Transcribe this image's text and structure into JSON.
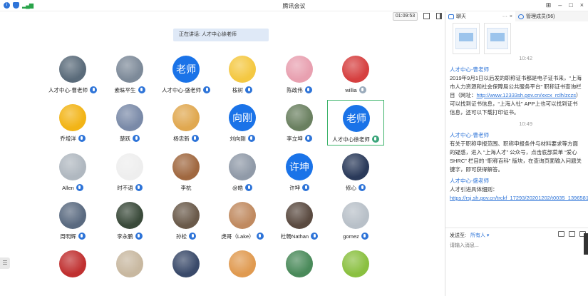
{
  "window": {
    "title": "腾讯会议",
    "timer": "01:09:53"
  },
  "speaker_banner": "正在讲话: 人才中心徐老师",
  "participants": [
    {
      "name": "人才中心-曹老师",
      "avatar": "photo",
      "color": "#5a6b7a",
      "mic": "on"
    },
    {
      "name": "素昧平生",
      "avatar": "photo",
      "color": "#7d8a99",
      "mic": "on"
    },
    {
      "name": "人才中心-盛老师",
      "avatar": "text",
      "avatar_text": "老师",
      "mic": "on"
    },
    {
      "name": "桉树",
      "avatar": "photo",
      "color": "#f4c842",
      "mic": "on"
    },
    {
      "name": "陈政伟",
      "avatar": "photo",
      "color": "#e8a0b0",
      "mic": "on"
    },
    {
      "name": "willia",
      "avatar": "photo",
      "color": "#d64040",
      "mic": "dim"
    },
    {
      "name": "乔增洋",
      "avatar": "photo",
      "color": "#f2b416",
      "mic": "on"
    },
    {
      "name": "楚跃",
      "avatar": "photo",
      "color": "#7a8aa8",
      "mic": "on"
    },
    {
      "name": "杨忠新",
      "avatar": "photo",
      "color": "#e0a850",
      "mic": "on"
    },
    {
      "name": "刘向刚",
      "avatar": "text",
      "avatar_text": "向刚",
      "mic": "on"
    },
    {
      "name": "李立坤",
      "avatar": "photo",
      "color": "#6a8060",
      "mic": "on"
    },
    {
      "name": "人才中心徐老师",
      "avatar": "text",
      "avatar_text": "老师",
      "mic": "speaking",
      "active": true
    },
    {
      "name": "Allen",
      "avatar": "photo",
      "color": "#b0b8c0",
      "mic": "on"
    },
    {
      "name": "时不语",
      "avatar": "photo",
      "color": "#eeeeee",
      "mic": "on"
    },
    {
      "name": "李杭",
      "avatar": "photo",
      "color": "#a06840",
      "mic": "none"
    },
    {
      "name": "@皓",
      "avatar": "photo",
      "color": "#909aa8",
      "mic": "on"
    },
    {
      "name": "许坤",
      "avatar": "text",
      "avatar_text": "许坤",
      "mic": "on"
    },
    {
      "name": "修心",
      "avatar": "photo",
      "color": "#2a3a5a",
      "mic": "on"
    },
    {
      "name": "周明辉",
      "avatar": "photo",
      "color": "#5a6a80",
      "mic": "on"
    },
    {
      "name": "李永鹏",
      "avatar": "photo",
      "color": "#3a4a3a",
      "mic": "on"
    },
    {
      "name": "孙松",
      "avatar": "photo",
      "color": "#6a5a4a",
      "mic": "on"
    },
    {
      "name": "虎哥（Lake）",
      "avatar": "photo",
      "color": "#c08a60",
      "mic": "on"
    },
    {
      "name": "杜畅Nathan",
      "avatar": "photo",
      "color": "#5a4a40",
      "mic": "on"
    },
    {
      "name": "gomez",
      "avatar": "photo",
      "color": "#b8c0c8",
      "mic": "on"
    },
    {
      "name": "",
      "avatar": "photo",
      "color": "#c03030",
      "mic": "none"
    },
    {
      "name": "",
      "avatar": "photo",
      "color": "#c8b8a0",
      "mic": "none"
    },
    {
      "name": "",
      "avatar": "photo",
      "color": "#3a4a6a",
      "mic": "none"
    },
    {
      "name": "",
      "avatar": "photo",
      "color": "#e09a50",
      "mic": "none"
    },
    {
      "name": "",
      "avatar": "photo",
      "color": "#4a8a5a",
      "mic": "none"
    },
    {
      "name": "",
      "avatar": "photo",
      "color": "#8ac040",
      "mic": "none"
    }
  ],
  "panel": {
    "tab_chat": "聊天",
    "tab_more": "···",
    "tab_close": "×",
    "tab_members": "管理成员(56)",
    "messages": [
      {
        "time": "10:42"
      },
      {
        "sender": "人才中心-曹老师",
        "parts": [
          {
            "text": "2019年9月1日以后发的职称证书都是电子证书来，“上海市人力资源和社会保障局公共服务平台” 职称证书查询栏目（网址：",
            "link": false
          },
          {
            "text": "http://www.12333sh.gov.cn/xxcx_rclh/zczs",
            "link": true
          },
          {
            "text": "）可以找到证书信息，“上海人社” APP上也可以找到证书信息，还可以下载打印证书。",
            "link": false
          }
        ]
      },
      {
        "time": "10:49"
      },
      {
        "sender": "人才中心-曹老师",
        "parts": [
          {
            "text": "有关于职称申报范围、职称申报条件与材料要求等方面的疑惑，进入 “上海人才” 公众号，点击底部菜单 “爱心SHRC” 栏目的 “职称百科” 版块，在查询页面输入问题关键字，即可获得解答。",
            "link": false
          }
        ]
      },
      {
        "sender": "人才中心-盛老师",
        "parts": [
          {
            "text": "人才引进具体细则：",
            "link": false
          },
          {
            "text": "https://rsj.sh.gov.cn/trckf_17293/20201202/t0035_1396581.html",
            "link": true
          }
        ]
      }
    ],
    "to_label": "发送至:",
    "to_value": "所有人 ▾",
    "input_placeholder": "请输入消息..."
  }
}
